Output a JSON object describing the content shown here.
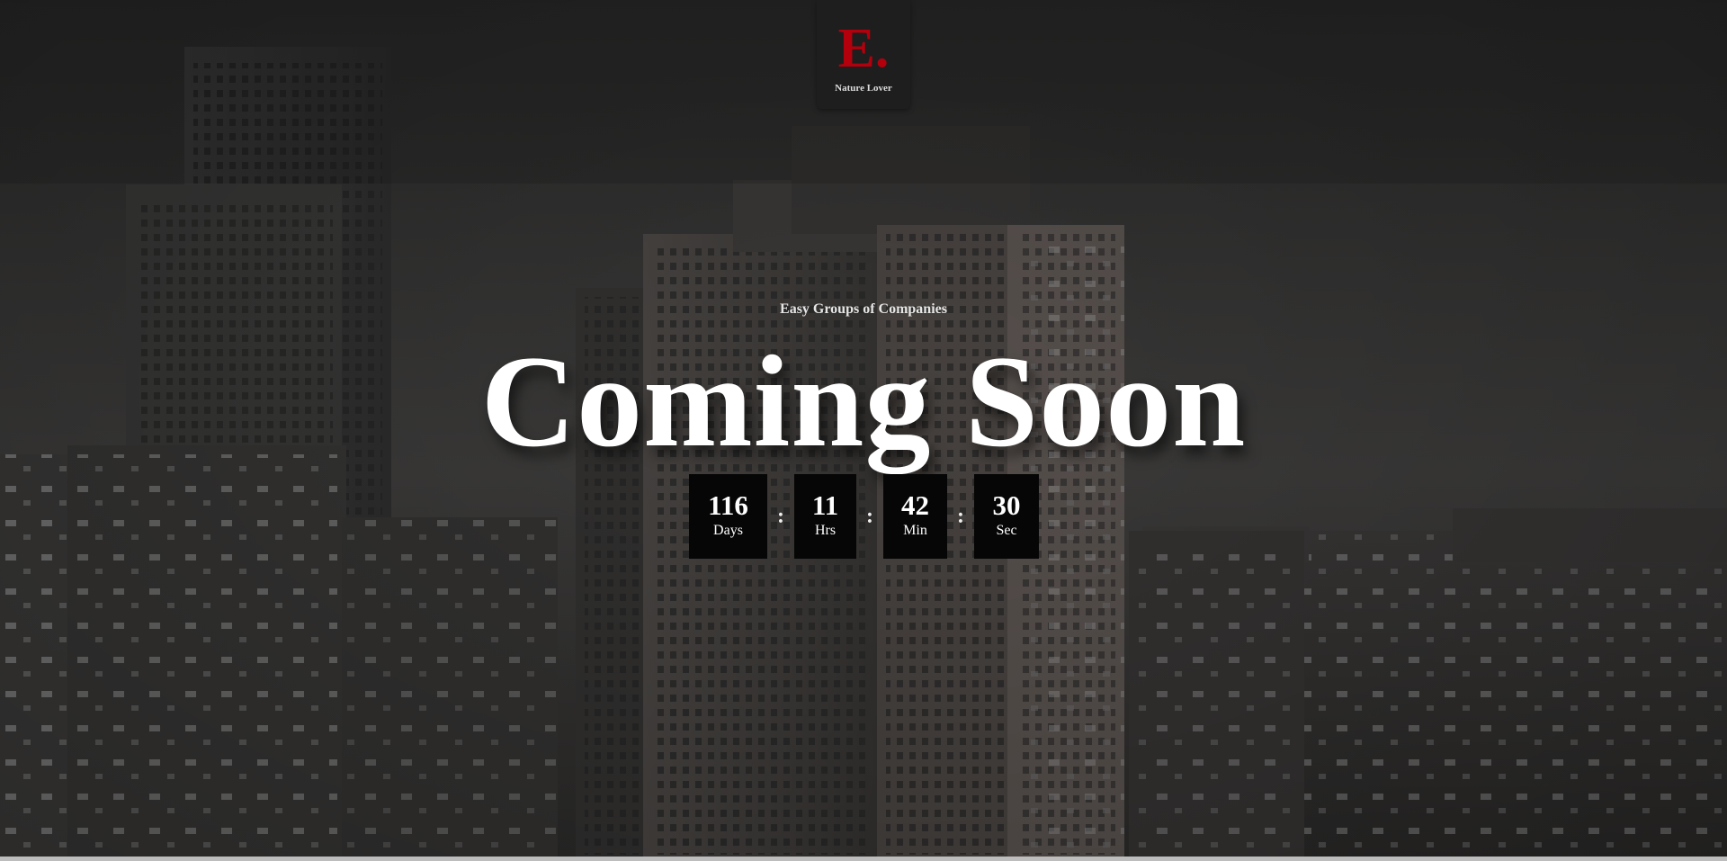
{
  "brand": {
    "logo_text": "E.",
    "tagline": "Nature Lover",
    "accent_color": "#b3000c"
  },
  "hero": {
    "company": "Easy Groups of Companies",
    "headline": "Coming Soon"
  },
  "countdown": {
    "separator": ":",
    "units": [
      {
        "value": "116",
        "label": "Days"
      },
      {
        "value": "11",
        "label": "Hrs"
      },
      {
        "value": "42",
        "label": "Min"
      },
      {
        "value": "30",
        "label": "Sec"
      }
    ]
  }
}
